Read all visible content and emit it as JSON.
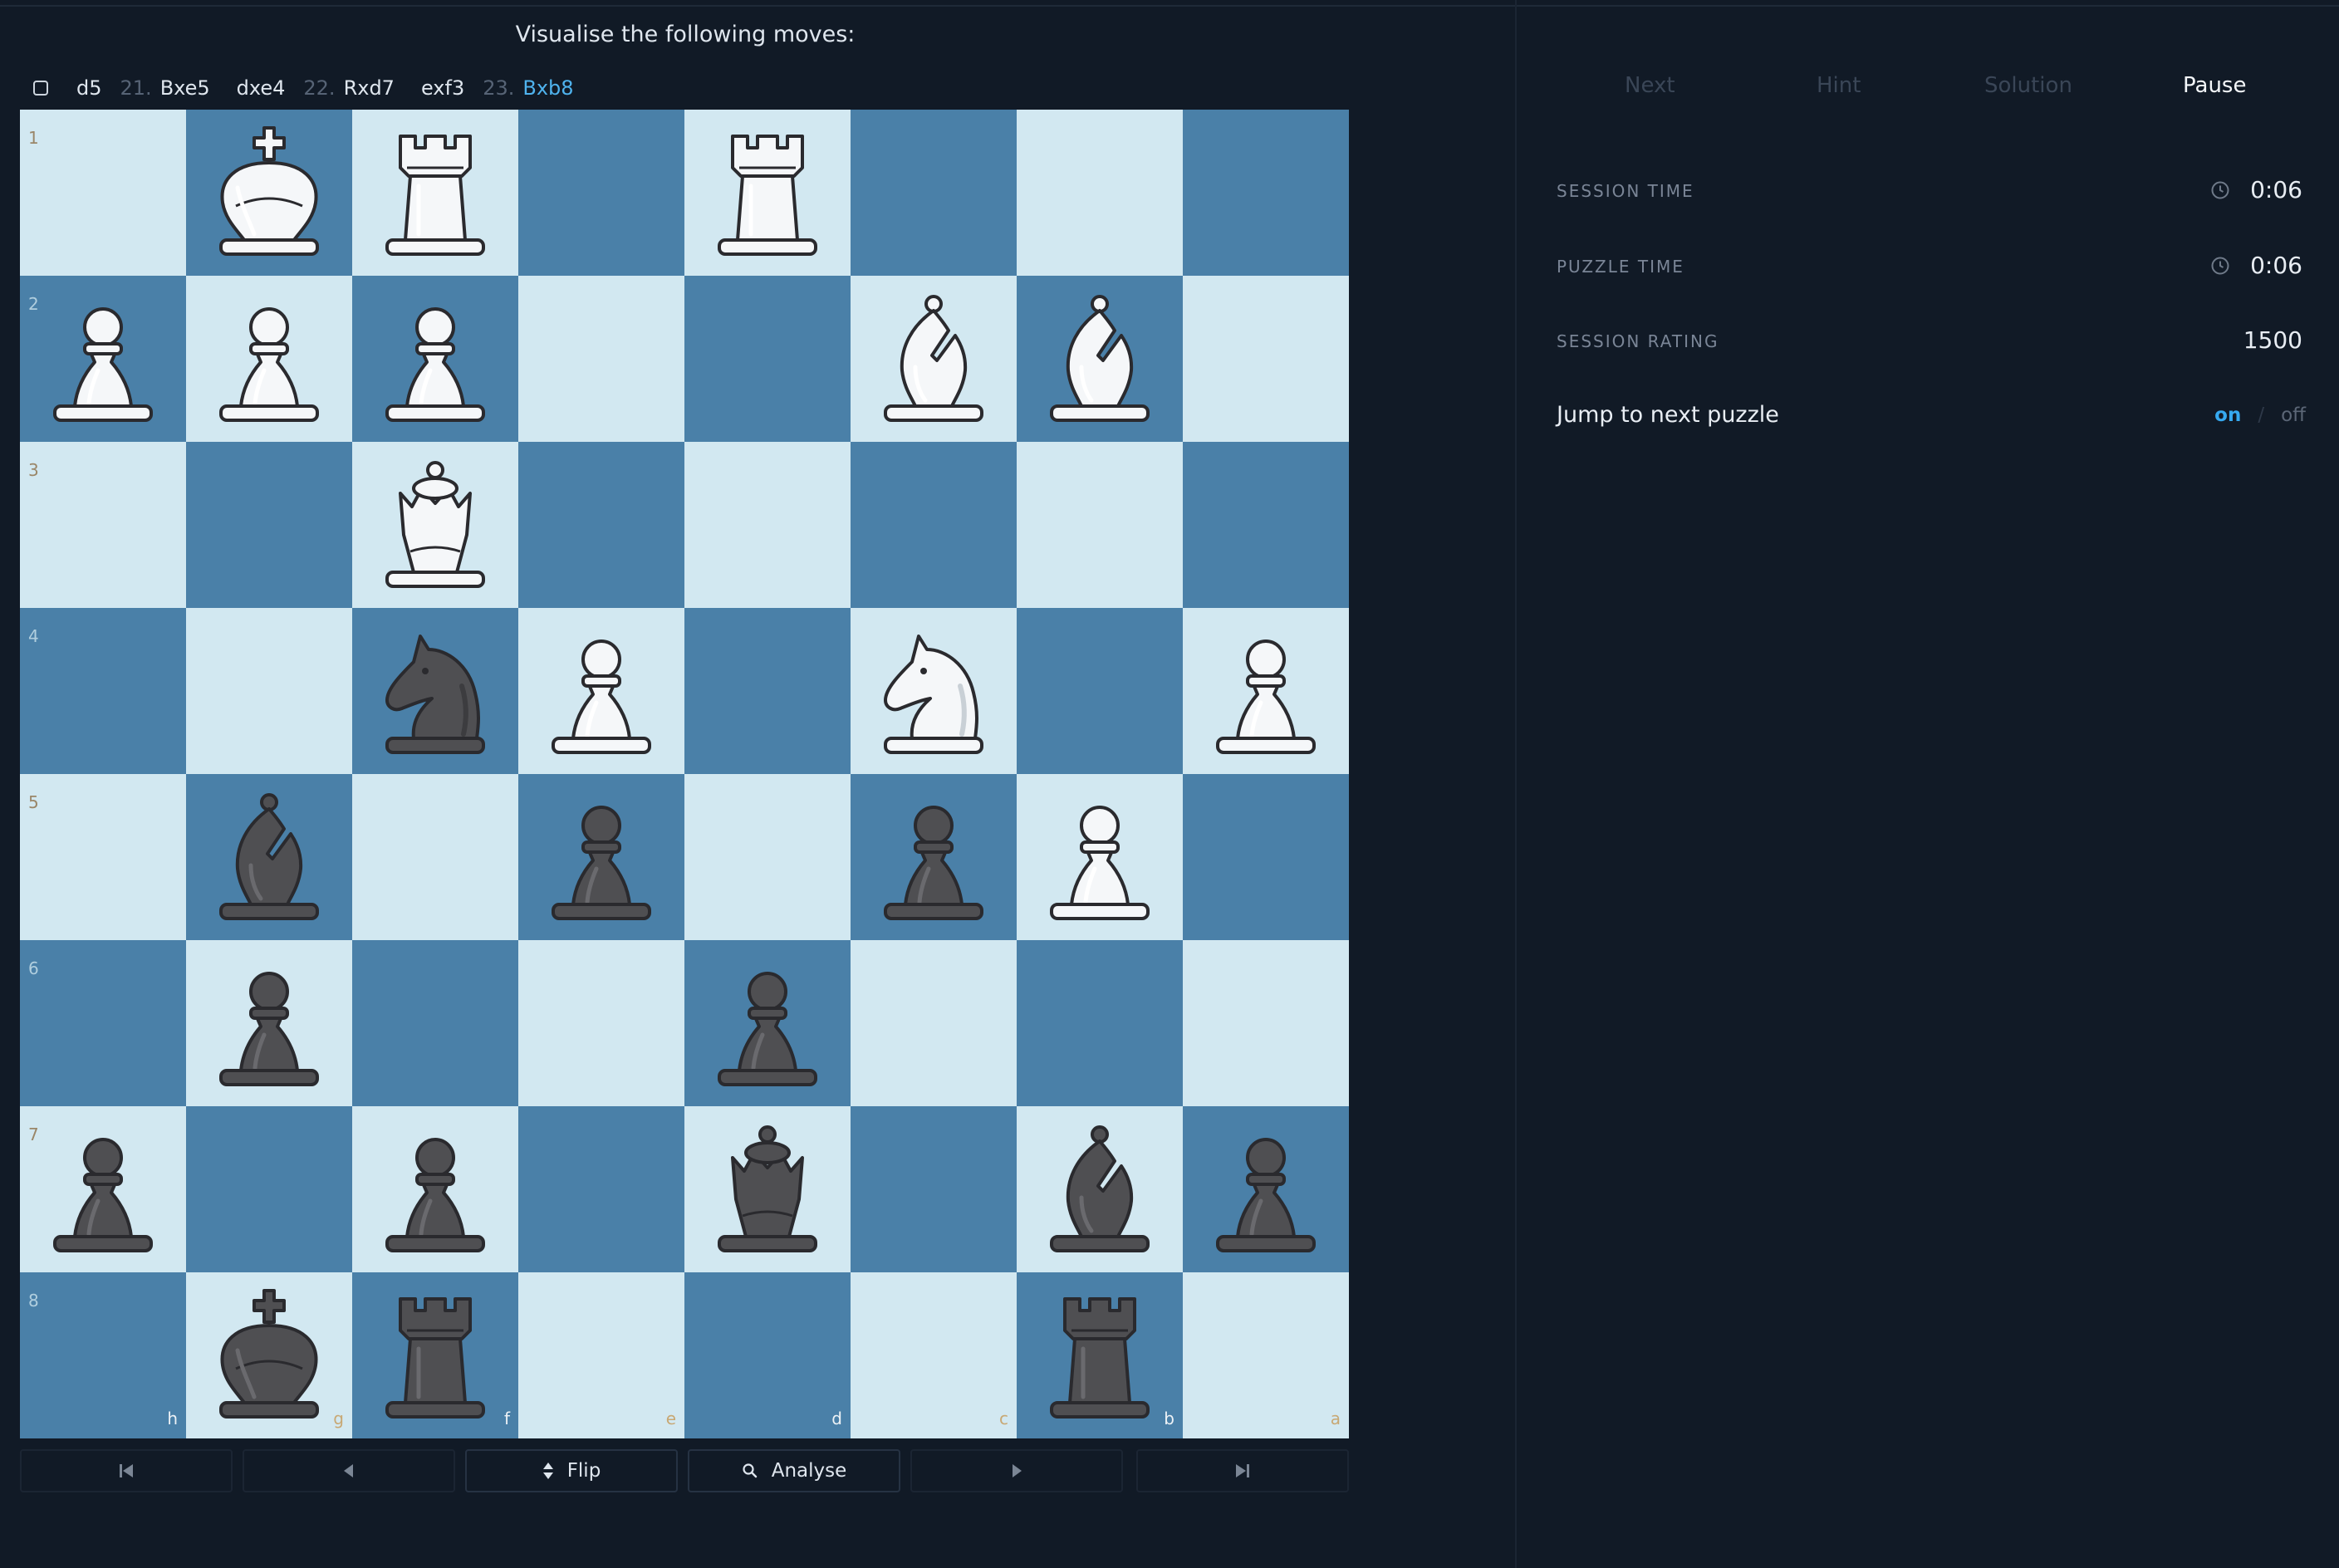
{
  "prompt": "Visualise the following moves:",
  "moves": [
    {
      "num": "",
      "san": "d5"
    },
    {
      "num": "21.",
      "san": "Bxe5"
    },
    {
      "num": "",
      "san": "dxe4"
    },
    {
      "num": "22.",
      "san": "Rxd7"
    },
    {
      "num": "",
      "san": "exf3"
    },
    {
      "num": "23.",
      "san": "Bxb8"
    }
  ],
  "board": {
    "orientation": "black",
    "colors": {
      "light": "#d2e8f1",
      "dark": "#4a80a8"
    },
    "rank_labels": [
      "1",
      "2",
      "3",
      "4",
      "5",
      "6",
      "7",
      "8"
    ],
    "file_labels": [
      "h",
      "g",
      "f",
      "e",
      "d",
      "c",
      "b",
      "a"
    ],
    "pieces": [
      [
        "",
        "wK",
        "wR",
        "",
        "wR",
        "",
        "",
        ""
      ],
      [
        "wP",
        "wP",
        "wP",
        "",
        "",
        "wB",
        "wB",
        ""
      ],
      [
        "",
        "",
        "wQ",
        "",
        "",
        "",
        "",
        ""
      ],
      [
        "",
        "",
        "bN",
        "wP",
        "",
        "wN",
        "",
        "wP"
      ],
      [
        "",
        "bB",
        "",
        "bP",
        "",
        "bP",
        "wP",
        ""
      ],
      [
        "",
        "bP",
        "",
        "",
        "bP",
        "",
        "",
        ""
      ],
      [
        "bP",
        "",
        "bP",
        "",
        "bQ",
        "",
        "bB",
        "bP"
      ],
      [
        "",
        "bK",
        "bR",
        "",
        "",
        "",
        "bR",
        ""
      ]
    ]
  },
  "controls": {
    "first_icon": "skip-back-icon",
    "prev_icon": "chevron-left-icon",
    "flip_label": "Flip",
    "analyse_label": "Analyse",
    "next_icon": "chevron-right-icon",
    "last_icon": "skip-forward-icon"
  },
  "sidebar": {
    "actions": {
      "next": "Next",
      "hint": "Hint",
      "solution": "Solution",
      "pause": "Pause"
    },
    "session_time_label": "SESSION TIME",
    "session_time": "0:06",
    "puzzle_time_label": "PUZZLE TIME",
    "puzzle_time": "0:06",
    "session_rating_label": "SESSION RATING",
    "session_rating": "1500",
    "jump_label": "Jump to next puzzle",
    "jump_on": "on",
    "jump_sep": "/",
    "jump_off": "off",
    "accent": "#36a9f0"
  }
}
